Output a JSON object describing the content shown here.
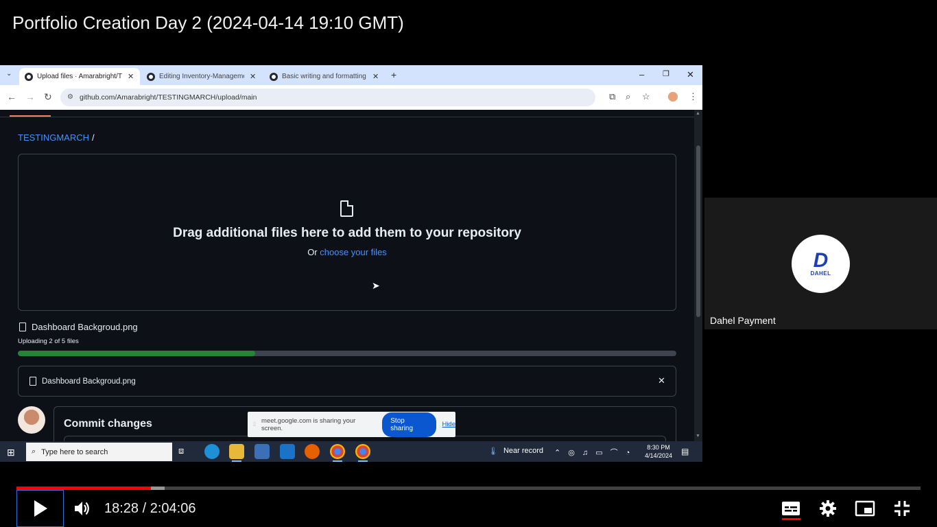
{
  "video": {
    "title": "Portfolio Creation Day 2 (2024-04-14 19:10 GMT)",
    "time_current": "18:28",
    "time_total": "2:04:06",
    "time_display": "18:28 / 2:04:06",
    "progress_played": 0.149,
    "progress_buffered": 0.164,
    "colors": {
      "played": "#ff0000",
      "accent": "#2f6fd8"
    }
  },
  "browser": {
    "tabs": [
      {
        "label": "Upload files · Amarabright/TEST",
        "active": true
      },
      {
        "label": "Editing Inventory-Management",
        "active": false
      },
      {
        "label": "Basic writing and formatting sy",
        "active": false
      }
    ],
    "url": "github.com/Amarabright/TESTINGMARCH/upload/main"
  },
  "github": {
    "repo_name": "TESTINGMARCH",
    "breadcrumb_sep": "/",
    "drop_heading": "Drag additional files here to add them to your repository",
    "drop_or": "Or ",
    "drop_link": "choose your files",
    "uploading_file": "Dashboard Backgroud.png",
    "upload_status": "Uploading 2 of 5 files",
    "upload_progress": 0.36,
    "file_list_item": "Dashboard Backgroud.png",
    "commit_title": "Commit changes",
    "colors": {
      "link": "#4493f8",
      "progress": "#238636",
      "bg": "#0d1117"
    }
  },
  "share_bar": {
    "message": "meet.google.com is sharing your screen.",
    "stop_label": "Stop sharing",
    "hide_label": "Hide"
  },
  "taskbar": {
    "search_placeholder": "Type here to search",
    "weather": "Near record",
    "time": "8:30 PM",
    "date": "4/14/2024"
  },
  "participant": {
    "name": "Dahel Payment",
    "logo_text": "DAHEL"
  }
}
